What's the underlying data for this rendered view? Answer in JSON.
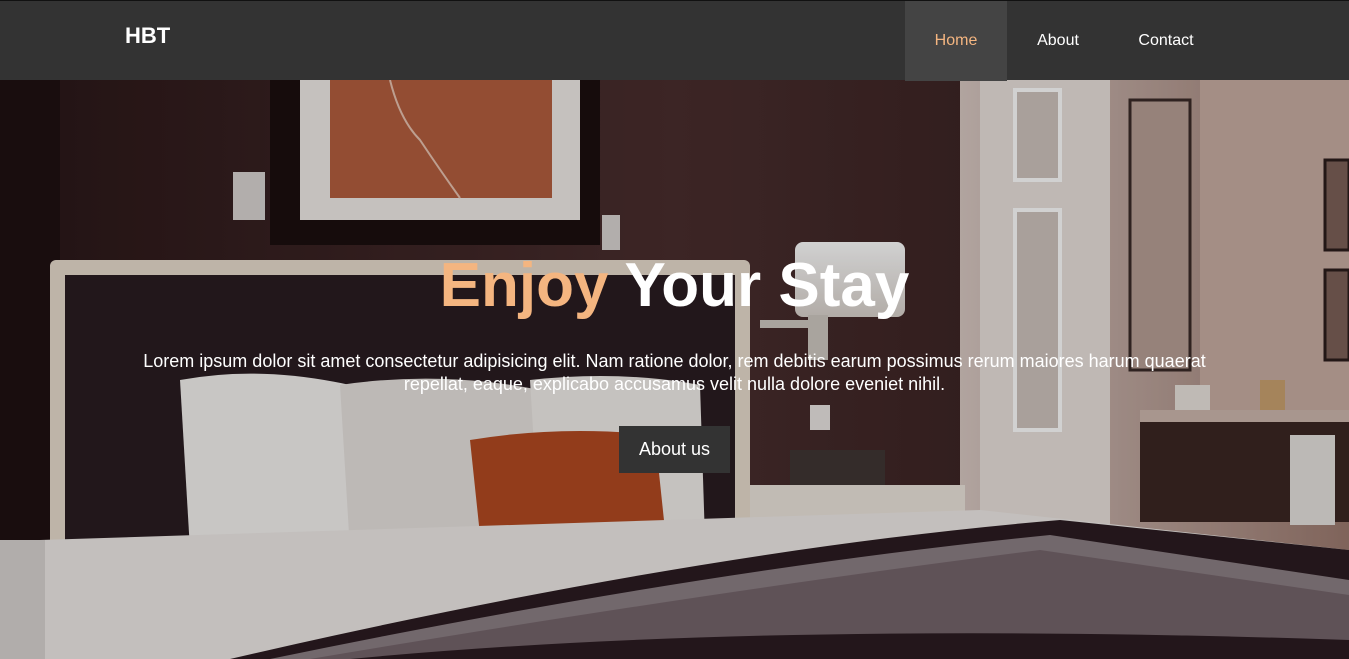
{
  "navbar": {
    "brand": "HBT",
    "links": [
      {
        "label": "Home",
        "active": true
      },
      {
        "label": "About",
        "active": false
      },
      {
        "label": "Contact",
        "active": false
      }
    ]
  },
  "hero": {
    "title_accent": "Enjoy",
    "title_rest": " Your Stay",
    "text": "Lorem ipsum dolor sit amet consectetur adipisicing elit. Nam ratione dolor, rem debitis earum possimus rerum maiores harum quaerat repellat, eaque, explicabo accusamus velit nulla dolore eveniet nihil.",
    "button_label": "About us",
    "background_image": "hotel-bedroom-photo"
  },
  "colors": {
    "accent": "#f4b580",
    "navbar_bg": "#333333",
    "active_link_bg": "#444444",
    "button_bg": "#333333"
  }
}
